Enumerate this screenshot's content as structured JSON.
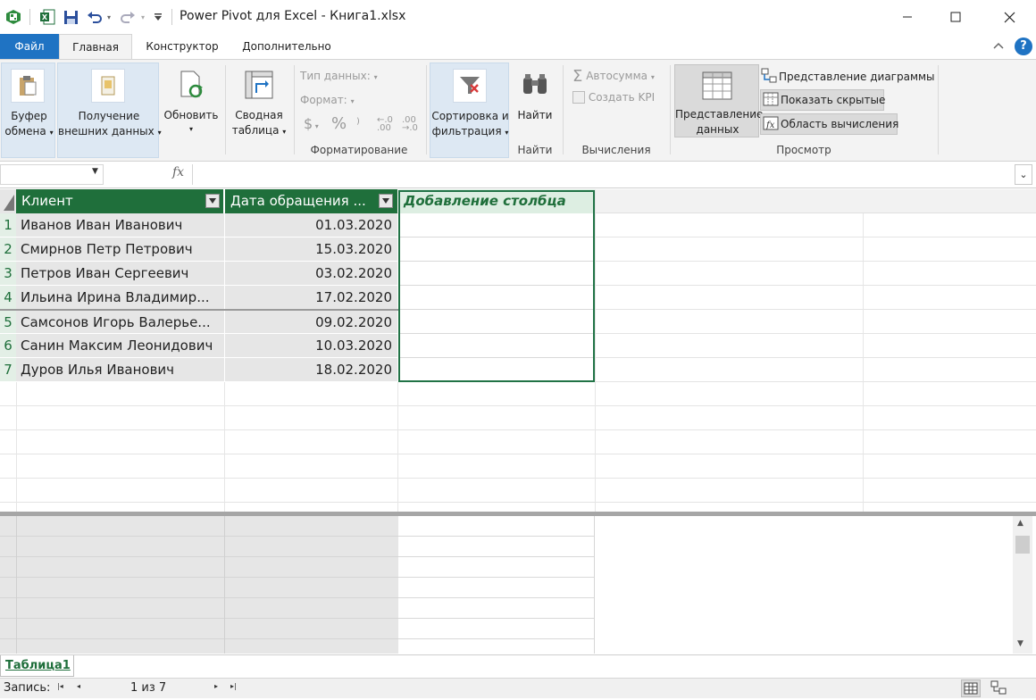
{
  "window": {
    "title": "Power Pivot для Excel - Книга1.xlsx"
  },
  "tabs": [
    {
      "label": "Файл"
    },
    {
      "label": "Главная"
    },
    {
      "label": "Конструктор"
    },
    {
      "label": "Дополнительно"
    }
  ],
  "ribbon": {
    "clipboard": {
      "line1": "Буфер",
      "line2": "обмена"
    },
    "get_data": {
      "line1": "Получение",
      "line2": "внешних данных"
    },
    "refresh": {
      "line1": "Обновить"
    },
    "pivot": {
      "line1": "Сводная",
      "line2": "таблица"
    },
    "data_type": "Тип данных:",
    "format": "Формат:",
    "currency_symbol": "$",
    "percent_symbol": "%",
    "comma_symbol": "⁾",
    "formatting_label": "Форматирование",
    "sort": {
      "line1": "Сортировка и",
      "line2": "фильтрация"
    },
    "find": {
      "label": "Найти",
      "group": "Найти"
    },
    "autosum": "Автосумма",
    "create_kpi": "Создать KPI",
    "calc_label": "Вычисления",
    "data_view": {
      "line1": "Представление",
      "line2": "данных"
    },
    "diagram_view": "Представление диаграммы",
    "show_hidden": "Показать скрытые",
    "calc_area": "Область вычисления",
    "view_label": "Просмотр"
  },
  "formula_bar": {
    "fx": "fx",
    "name_box": "",
    "formula": ""
  },
  "table": {
    "columns": [
      "Клиент",
      "Дата обращения ...",
      "Добавление столбца"
    ],
    "rows": [
      {
        "n": "1",
        "client": "Иванов Иван Иванович",
        "date": "01.03.2020"
      },
      {
        "n": "2",
        "client": "Смирнов Петр Петрович",
        "date": "15.03.2020"
      },
      {
        "n": "3",
        "client": "Петров Иван Сергеевич",
        "date": "03.02.2020"
      },
      {
        "n": "4",
        "client": "Ильина Ирина Владимир...",
        "date": "17.02.2020"
      },
      {
        "n": "5",
        "client": "Самсонов Игорь Валерье...",
        "date": "09.02.2020"
      },
      {
        "n": "6",
        "client": "Санин Максим Леонидович",
        "date": "10.03.2020"
      },
      {
        "n": "7",
        "client": "Дуров Илья Иванович",
        "date": "18.02.2020"
      }
    ]
  },
  "sheet_tab": "Таблица1",
  "status": {
    "record_label": "Запись:",
    "position": "1 из 7"
  },
  "colors": {
    "header_green": "#1f6f3b",
    "file_tab_blue": "#1f73c3",
    "selection_green": "#217346"
  }
}
